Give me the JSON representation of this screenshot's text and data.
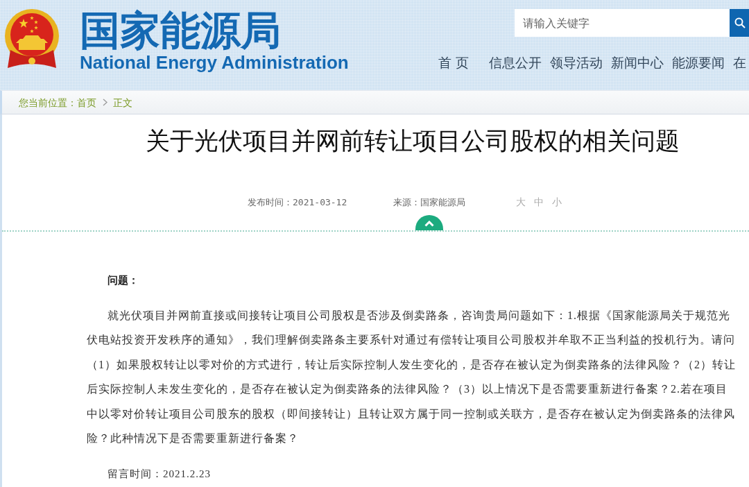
{
  "header": {
    "site_name": "国家能源局",
    "site_name_en": "National Energy Administration",
    "search": {
      "placeholder": "请输入关键字"
    },
    "nav": [
      "首 页",
      "信息公开",
      "领导活动",
      "新闻中心",
      "能源要闻",
      "在"
    ]
  },
  "breadcrumb": {
    "prefix": "您当前位置：",
    "items": [
      "首页",
      "正文"
    ]
  },
  "article": {
    "title": "关于光伏项目并网前转让项目公司股权的相关问题",
    "publish_time": "发布时间：2021-03-12",
    "source": "来源：国家能源局",
    "font_size_options": [
      "大",
      "中",
      "小"
    ],
    "question_label": "问题：",
    "question": "就光伏项目并网前直接或间接转让项目公司股权是否涉及倒卖路条，咨询贵局问题如下：1.根据《国家能源局关于规范光伏电站投资开发秩序的通知》，我们理解倒卖路条主要系针对通过有偿转让项目公司股权并牟取不正当利益的投机行为。请问（1）如果股权转让以零对价的方式进行，转让后实际控制人发生变化的，是否存在被认定为倒卖路条的法律风险？（2）转让后实际控制人未发生变化的，是否存在被认定为倒卖路条的法律风险？（3）以上情况下是否需要重新进行备案？2.若在项目中以零对价转让项目公司股东的股权（即间接转让）且转让双方属于同一控制或关联方，是否存在被认定为倒卖路条的法律风险？此种情况下是否需要重新进行备案？",
    "message_time": "留言时间：2021.2.23"
  }
}
